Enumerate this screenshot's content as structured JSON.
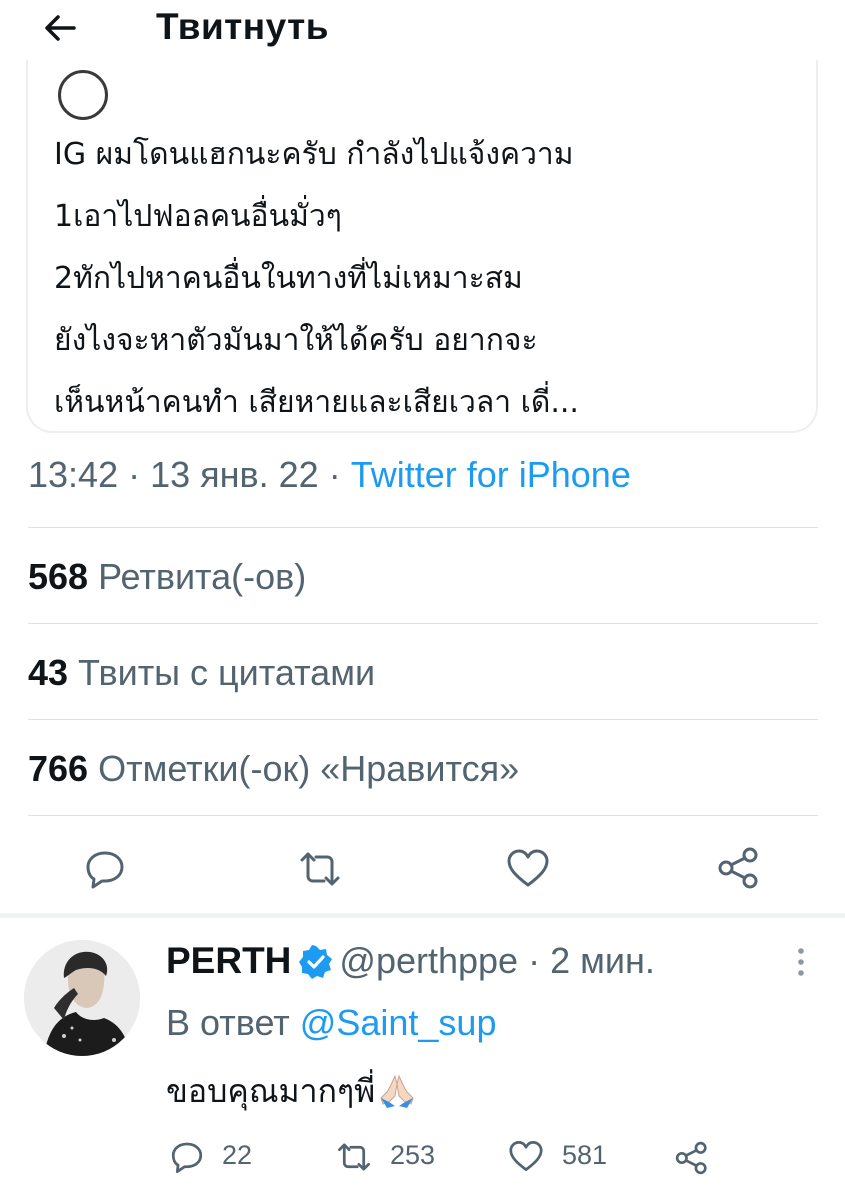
{
  "header": {
    "title": "Твитнуть"
  },
  "quoted": {
    "lines": [
      "IG ผมโดนแฮกนะครับ กำลังไปแจ้งความ",
      "1เอาไปฟอลคนอื่นมั่วๆ",
      "2ทักไปหาคนอื่นในทางที่ไม่เหมาะสม",
      "ยังไงจะหาตัวมันมาให้ได้ครับ อยากจะ",
      "เห็นหน้าคนทำ เสียหายและเสียเวลา เดี่..."
    ]
  },
  "meta": {
    "time": "13:42",
    "date": "13 янв. 22",
    "source": "Twitter for iPhone"
  },
  "stats": {
    "retweets": {
      "count": "568",
      "label": "Ретвита(-ов)"
    },
    "quotes": {
      "count": "43",
      "label": "Твиты с цитатами"
    },
    "likes": {
      "count": "766",
      "label": "Отметки(-ок) «Нравится»"
    }
  },
  "reply": {
    "name": "PERTH",
    "handle": "@perthppe",
    "time": "2 мин.",
    "reply_prefix": "В ответ",
    "reply_mention": "@Saint_sup",
    "text": "ขอบคุณมากๆพี่",
    "counts": {
      "replies": "22",
      "retweets": "253",
      "likes": "581"
    }
  },
  "icons": {
    "back": "arrow-left-icon",
    "reply": "speech-bubble-icon",
    "retweet": "retweet-arrows-icon",
    "like": "heart-icon",
    "share": "share-nodes-icon",
    "verified": "verified-badge-icon",
    "more": "more-vertical-icon"
  },
  "colors": {
    "accent": "#1d9bf0",
    "text": "#0f1419",
    "secondary": "#536471",
    "divider": "#dde3e7"
  }
}
